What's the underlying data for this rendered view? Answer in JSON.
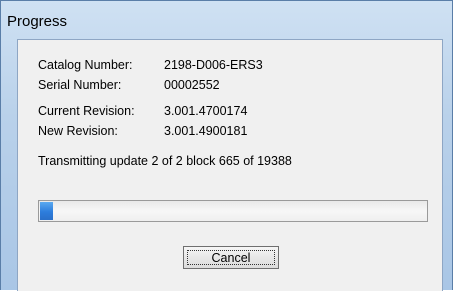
{
  "window": {
    "title": "Progress"
  },
  "info": {
    "catalog_label": "Catalog Number:",
    "catalog_value": "2198-D006-ERS3",
    "serial_label": "Serial Number:",
    "serial_value": "00002552",
    "current_label": "Current Revision:",
    "current_value": "3.001.4700174",
    "new_label": "New Revision:",
    "new_value": "3.001.4900181"
  },
  "status": {
    "text": "Transmitting update 2 of 2  block 665 of 19388"
  },
  "progress": {
    "fraction": 0.034,
    "color": "#2d7ddc"
  },
  "buttons": {
    "cancel_label": "Cancel"
  }
}
